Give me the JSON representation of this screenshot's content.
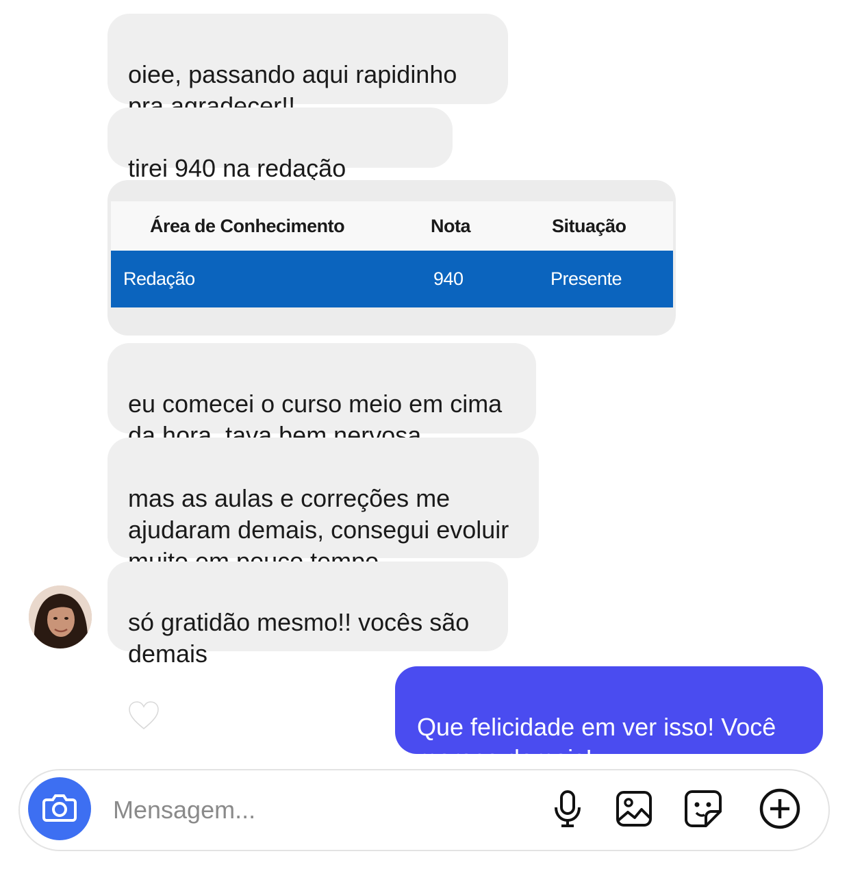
{
  "messages": [
    {
      "text": "oiee, passando aqui rapidinho\npra agradecer!!"
    },
    {
      "text": "tirei 940 na redação"
    },
    {
      "text": "eu comecei o curso meio em cima\nda hora, tava bem nervosa"
    },
    {
      "text": "mas as aulas e correções me\najudaram demais, consegui evoluir\nmuito em pouco tempo"
    },
    {
      "text": "só gratidão mesmo!! vocês são\ndemais"
    }
  ],
  "reply": {
    "text": "Que felicidade em ver isso! Você\nmerece demais!"
  },
  "result_table": {
    "headers": [
      "Área de Conhecimento",
      "Nota",
      "Situação"
    ],
    "row": [
      "Redação",
      "940",
      "Presente"
    ]
  },
  "composer": {
    "placeholder": "Mensagem..."
  },
  "icons": [
    "camera-icon",
    "microphone-icon",
    "image-icon",
    "sticker-icon",
    "plus-icon",
    "crying-face-emoji",
    "red-heart-emoji",
    "white-heart-emoji"
  ],
  "colors": {
    "sent_bubble": "#4a4cf0",
    "received_bubble": "#efefef",
    "table_row": "#0b64be",
    "camera_button": "#3d6ff2"
  }
}
